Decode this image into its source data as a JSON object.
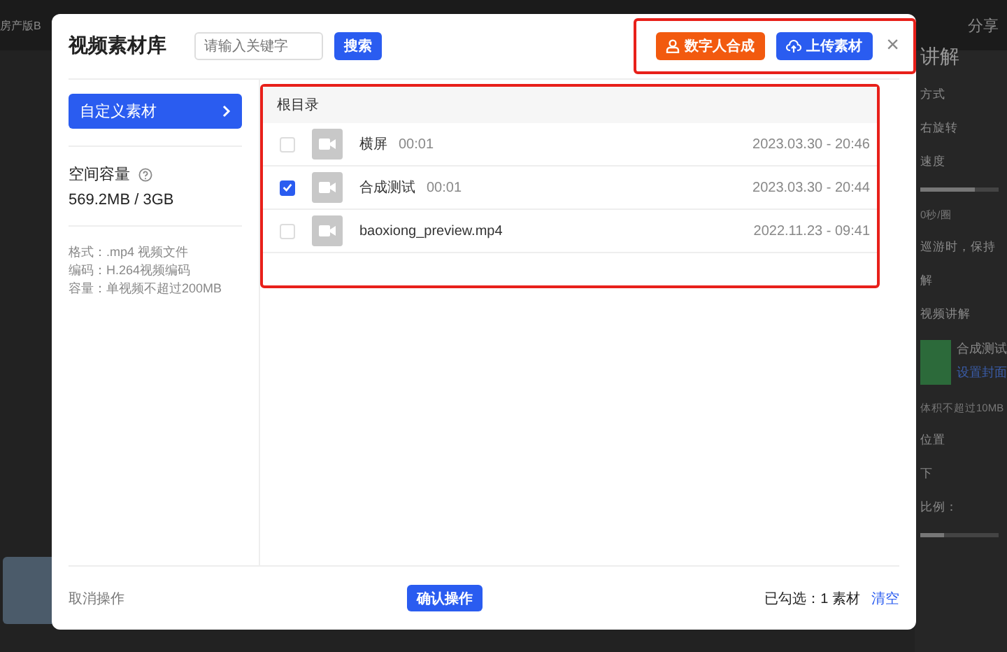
{
  "background": {
    "project": "房产版B",
    "share": "分享",
    "panel_items": [
      {
        "kind": "title",
        "text": "讲解"
      },
      {
        "kind": "text",
        "text": "方式"
      },
      {
        "kind": "text",
        "text": "右旋转"
      },
      {
        "kind": "text",
        "text": "速度"
      },
      {
        "kind": "slider",
        "level": 0.7
      },
      {
        "kind": "hint",
        "text": "0秒/圈"
      },
      {
        "kind": "text",
        "text": "巡游时，保持"
      },
      {
        "kind": "text",
        "text": "解"
      },
      {
        "kind": "text",
        "text": "视频讲解"
      },
      {
        "kind": "video",
        "title": "合成测试",
        "link": "设置封面"
      },
      {
        "kind": "hint",
        "text": "体积不超过10MB"
      },
      {
        "kind": "text",
        "text": "位置"
      },
      {
        "kind": "text",
        "text": "下"
      },
      {
        "kind": "text",
        "text": "比例："
      },
      {
        "kind": "slider",
        "level": 0.3
      }
    ]
  },
  "dialog": {
    "title": "视频素材库",
    "search": {
      "placeholder": "请输入关键字",
      "button": "搜索"
    },
    "close": "×",
    "actions": [
      {
        "kind": "person",
        "label": "数字人合成"
      },
      {
        "kind": "upload",
        "label": "上传素材"
      }
    ],
    "sidebar": {
      "category": "自定义素材",
      "storage_label": "空间容量",
      "storage_value": "569.2MB / 3GB",
      "notes": [
        "格式：.mp4 视频文件",
        "编码：H.264视频编码",
        "容量：单视频不超过200MB"
      ]
    },
    "folder": "根目录",
    "files": [
      {
        "name": "横屏",
        "duration": "00:01",
        "date": "2023.03.30 - 20:46",
        "checked": false
      },
      {
        "name": "合成测试",
        "duration": "00:01",
        "date": "2023.03.30 - 20:44",
        "checked": true
      },
      {
        "name": "baoxiong_preview.mp4",
        "date": "2022.11.23 - 09:41",
        "checked": false
      }
    ],
    "footer": {
      "cancel": "取消操作",
      "confirm": "确认操作",
      "selected": "已勾选：1 素材",
      "clear": "清空"
    }
  }
}
